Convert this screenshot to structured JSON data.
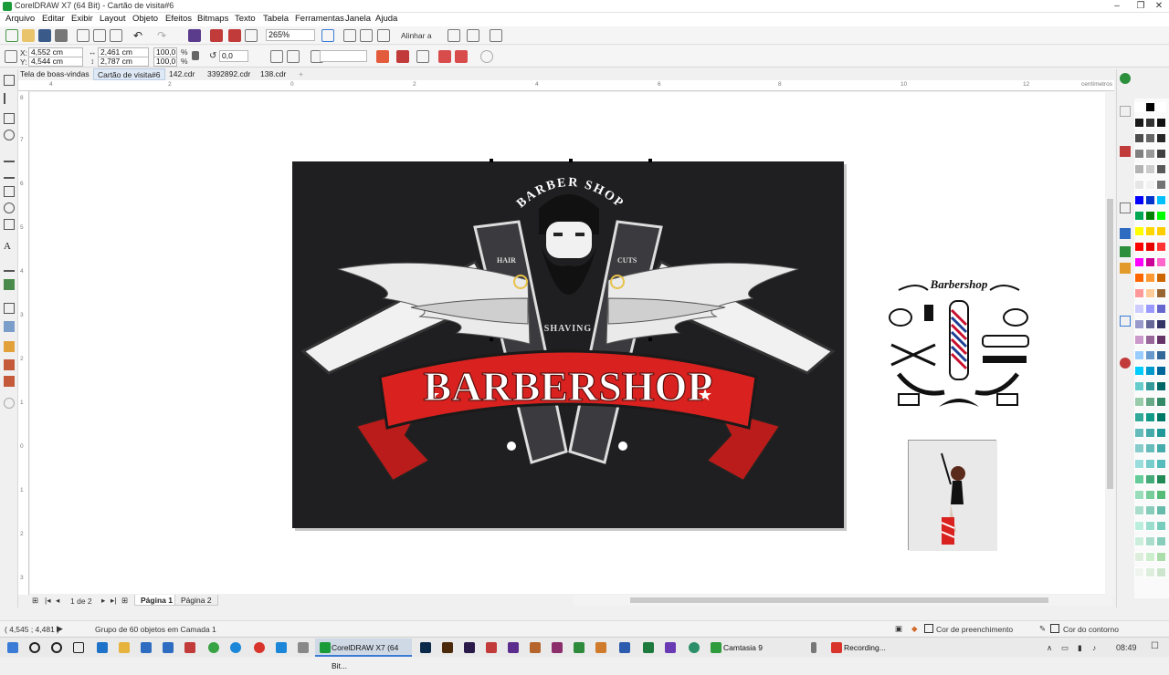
{
  "window": {
    "title": "CorelDRAW X7 (64 Bit) - Cartão de visita#6"
  },
  "menu": [
    "Arquivo",
    "Editar",
    "Exibir",
    "Layout",
    "Objeto",
    "Efeitos",
    "Bitmaps",
    "Texto",
    "Tabela",
    "Ferramentas",
    "Janela",
    "Ajuda"
  ],
  "toolbar": {
    "zoom": "265%",
    "align_label": "Alinhar a"
  },
  "properties": {
    "x_label": "X:",
    "x_value": "4,552 cm",
    "y_label": "Y:",
    "y_value": "4,544 cm",
    "width_value": "2,461 cm",
    "height_value": "2,787 cm",
    "scale_w": "100,0",
    "scale_h": "100,0",
    "percent": "%",
    "rotation": "0,0"
  },
  "doc_tabs": [
    "Tela de boas-vindas",
    "Cartão de visita#6",
    "142.cdr",
    "3392892.cdr",
    "138.cdr"
  ],
  "ruler": {
    "h_ticks": [
      "4",
      "2",
      "0",
      "2",
      "4",
      "6",
      "8",
      "10",
      "12"
    ],
    "unit": "centímetros",
    "v_ticks": [
      "8",
      "7",
      "6",
      "5",
      "4",
      "3",
      "2",
      "1",
      "0",
      "1",
      "2",
      "3"
    ]
  },
  "artwork": {
    "arc_text": "BARBER SHOP",
    "left_tag": "HAIR",
    "right_tag": "CUTS",
    "mid_text": "SHAVING",
    "banner": "BARBERSHOP",
    "clipart_title": "Barbershop"
  },
  "page_nav": {
    "counter": "1 de 2",
    "pages": [
      "Página 1",
      "Página 2"
    ]
  },
  "status": {
    "coords": "( 4,545 ; 4,481 )",
    "message": "Grupo de 60 objetos em Camada 1",
    "fill_label": "Cor de preenchimento",
    "outline_label": "Cor do contorno"
  },
  "taskbar": {
    "apps": [
      {
        "label": "CorelDRAW X7 (64 Bit...",
        "color": "#1a9b3a"
      },
      {
        "label": "Camtasia 9",
        "color": "#2e9b3c"
      },
      {
        "label": "Recording...",
        "color": "#d9342b"
      }
    ],
    "time": "08:49"
  },
  "colors": {
    "accent": "#3a7bd5",
    "card_bg": "#1f1e20",
    "banner_red": "#d9221f"
  }
}
